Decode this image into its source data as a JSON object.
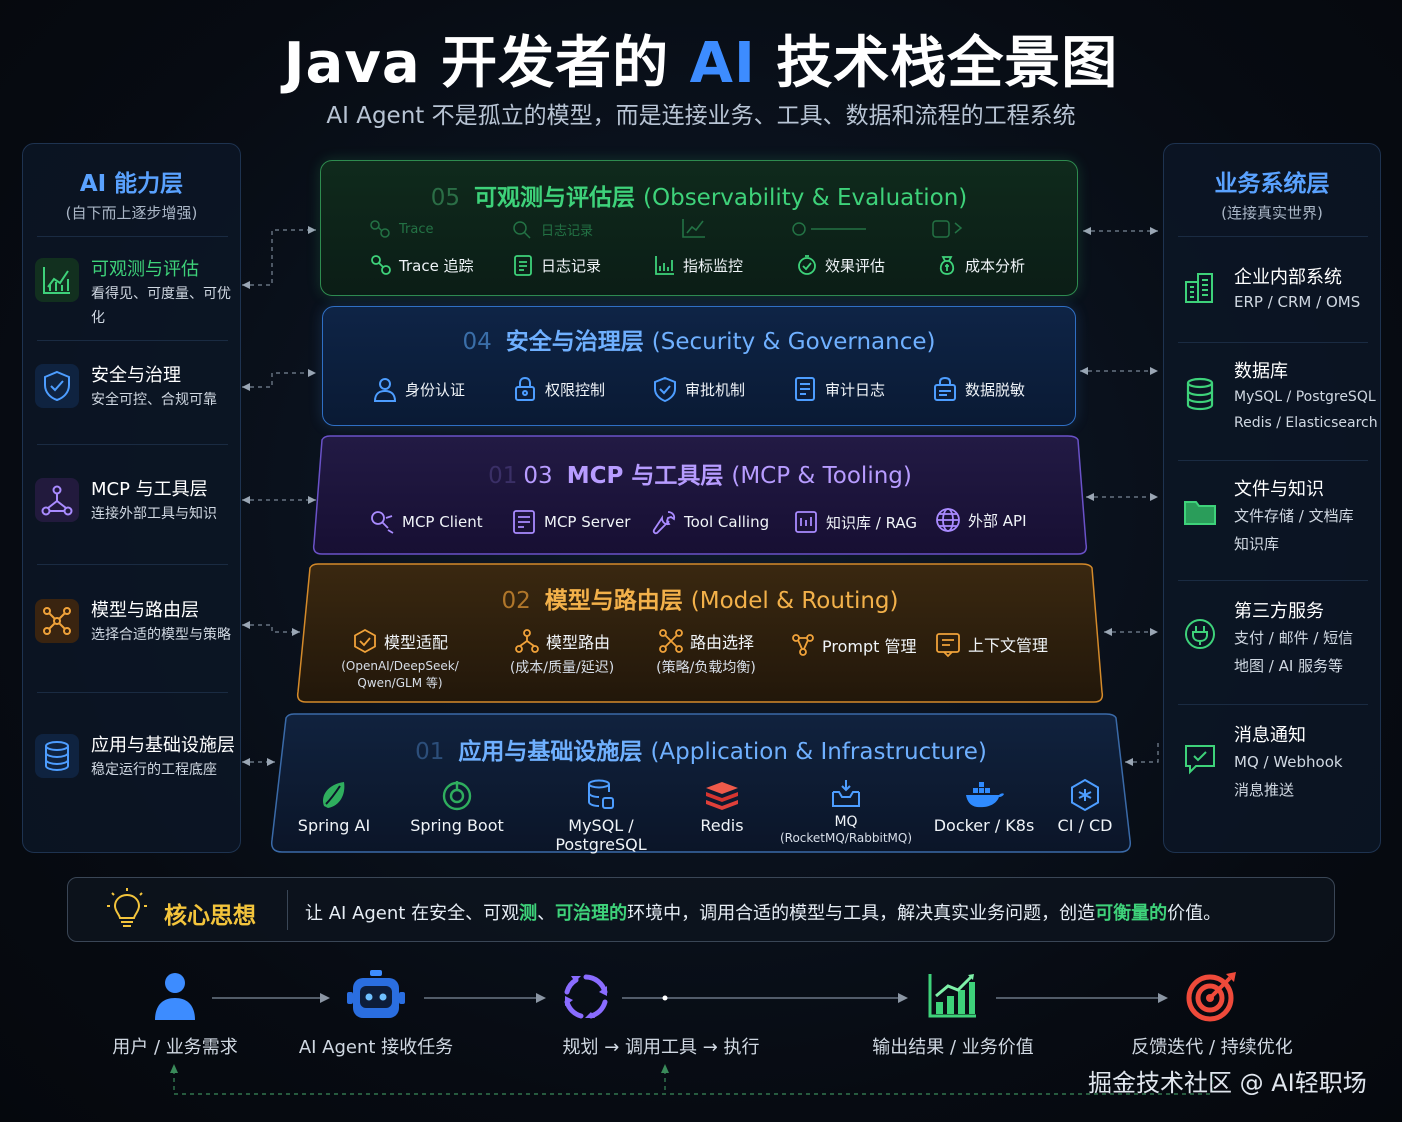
{
  "header": {
    "title_prefix": "Java 开发者的 ",
    "title_ai": "AI",
    "title_suffix": " 技术栈全景图",
    "subtitle": "AI Agent 不是孤立的模型，而是连接业务、工具、数据和流程的工程系统"
  },
  "left_panel": {
    "title": "AI 能力层",
    "subtitle": "(自下而上逐步增强)",
    "items": [
      {
        "title": "可观测与评估",
        "desc": "看得见、可度量、可优化",
        "icon": "chart-icon"
      },
      {
        "title": "安全与治理",
        "desc": "安全可控、合规可靠",
        "icon": "shield-icon"
      },
      {
        "title": "MCP 与工具层",
        "desc": "连接外部工具与知识",
        "icon": "network-icon"
      },
      {
        "title": "模型与路由层",
        "desc": "选择合适的模型与策略",
        "icon": "routing-icon"
      },
      {
        "title": "应用与基础设施层",
        "desc": "稳定运行的工程底座",
        "icon": "database-icon"
      }
    ]
  },
  "right_panel": {
    "title": "业务系统层",
    "subtitle": "(连接真实世界)",
    "items": [
      {
        "title": "企业内部系统",
        "desc": "ERP / CRM / OMS",
        "icon": "building-icon"
      },
      {
        "title": "数据库",
        "desc": "MySQL / PostgreSQL\nRedis / Elasticsearch",
        "icon": "database-icon"
      },
      {
        "title": "文件与知识",
        "desc": "文件存储 / 文档库\n知识库",
        "icon": "folder-icon"
      },
      {
        "title": "第三方服务",
        "desc": "支付 / 邮件 / 短信\n地图 / AI 服务等",
        "icon": "plug-icon"
      },
      {
        "title": "消息通知",
        "desc": "MQ / Webhook\n消息推送",
        "icon": "message-icon"
      }
    ]
  },
  "layers": {
    "l05": {
      "num": "05",
      "name": "可观测与评估层",
      "en": "(Observability & Evaluation)",
      "ghost": [
        "Trace",
        "日志记录",
        "",
        "",
        ""
      ],
      "items": [
        "Trace 追踪",
        "日志记录",
        "指标监控",
        "效果评估",
        "成本分析"
      ]
    },
    "l04": {
      "num": "04",
      "name": "安全与治理层",
      "en": "(Security & Governance)",
      "items": [
        "身份认证",
        "权限控制",
        "审批机制",
        "审计日志",
        "数据脱敏"
      ]
    },
    "l03": {
      "num": "03",
      "ghost_num": "01",
      "name": "MCP 与工具层",
      "en": "(MCP & Tooling)",
      "items": [
        "MCP Client",
        "MCP Server",
        "Tool Calling",
        "知识库 / RAG",
        "外部 API"
      ]
    },
    "l02": {
      "num": "02",
      "name": "模型与路由层",
      "en": "(Model & Routing)",
      "items": [
        {
          "label": "模型适配",
          "sub": "(OpenAI/DeepSeek/",
          "sub2": "Qwen/GLM 等)"
        },
        {
          "label": "模型路由",
          "sub": "(成本/质量/延迟)",
          "sub2": ""
        },
        {
          "label": "路由选择",
          "sub": "(策略/负载均衡)",
          "sub2": ""
        },
        {
          "label": "Prompt 管理",
          "sub": "",
          "sub2": ""
        },
        {
          "label": "上下文管理",
          "sub": "",
          "sub2": ""
        }
      ]
    },
    "l01": {
      "num": "01",
      "name": "应用与基础设施层",
      "en": "(Application & Infrastructure)",
      "items": [
        {
          "label": "Spring AI",
          "sub": ""
        },
        {
          "label": "Spring Boot",
          "sub": ""
        },
        {
          "label": "MySQL / PostgreSQL",
          "sub": ""
        },
        {
          "label": "Redis",
          "sub": ""
        },
        {
          "label": "MQ",
          "sub": "(RocketMQ/RabbitMQ)"
        },
        {
          "label": "Docker / K8s",
          "sub": ""
        },
        {
          "label": "CI / CD",
          "sub": ""
        }
      ]
    }
  },
  "core": {
    "title": "核心思想",
    "text_1": "让 AI Agent 在安全、可观",
    "text_g1": "测",
    "text_2": "、",
    "text_g2": "可治理的",
    "text_3": "环境中，调用合适的模型与工具，解决真实业务问题，创造",
    "text_g3": "可衡量的",
    "text_4": "价值。"
  },
  "flow": [
    {
      "label": "用户 / 业务需求",
      "icon": "user-icon"
    },
    {
      "label": "AI Agent 接收任务",
      "icon": "robot-icon"
    },
    {
      "label": "规划 → 调用工具 → 执行",
      "icon": "cycle-icon"
    },
    {
      "label": "输出结果 / 业务价值",
      "icon": "growth-chart-icon"
    },
    {
      "label": "反馈迭代 / 持续优化",
      "icon": "target-icon"
    }
  ],
  "watermark": "掘金技术社区 @ AI轻职场",
  "colors": {
    "green": "#3ed27a",
    "blue": "#4d9dff",
    "purple": "#a98bff",
    "orange": "#f0a23a",
    "gold": "#f3c43c"
  }
}
